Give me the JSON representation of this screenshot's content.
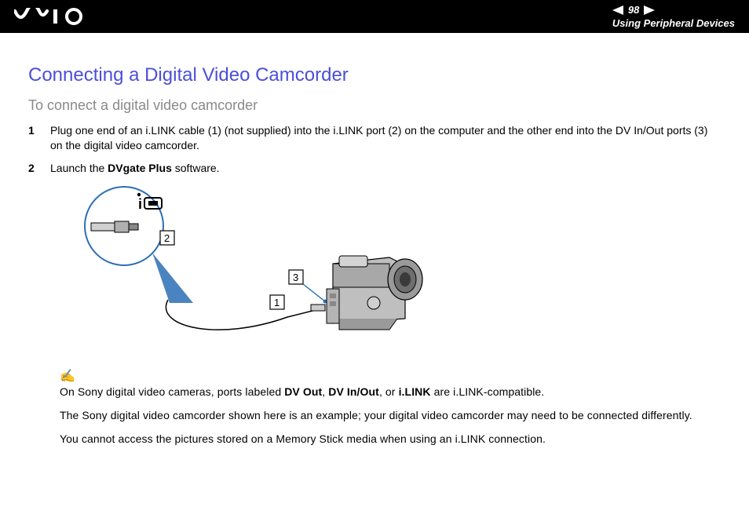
{
  "header": {
    "page_number": "98",
    "section_label": "Using Peripheral Devices"
  },
  "main": {
    "heading": "Connecting a Digital Video Camcorder",
    "subheading": "To connect a digital video camcorder",
    "steps": [
      {
        "num": "1",
        "text_before": "Plug one end of an i.LINK cable (1) (not supplied) into the i.LINK port (2) on the computer and the other end into the DV In/Out ports (3) on the digital video camcorder.",
        "bold": "",
        "text_after": ""
      },
      {
        "num": "2",
        "text_before": "Launch the ",
        "bold": "DVgate Plus",
        "text_after": " software."
      }
    ],
    "callouts": {
      "one": "1",
      "two": "2",
      "three": "3"
    },
    "notes": {
      "line1_a": "On Sony digital video cameras, ports labeled ",
      "line1_b1": "DV Out",
      "line1_c1": ", ",
      "line1_b2": "DV In/Out",
      "line1_c2": ", or ",
      "line1_b3": "i.LINK",
      "line1_d": " are i.LINK-compatible.",
      "line2": "The Sony digital video camcorder shown here is an example; your digital video camcorder may need to be connected differently.",
      "line3": "You cannot access the pictures stored on a Memory Stick media when using an i.LINK connection."
    }
  }
}
